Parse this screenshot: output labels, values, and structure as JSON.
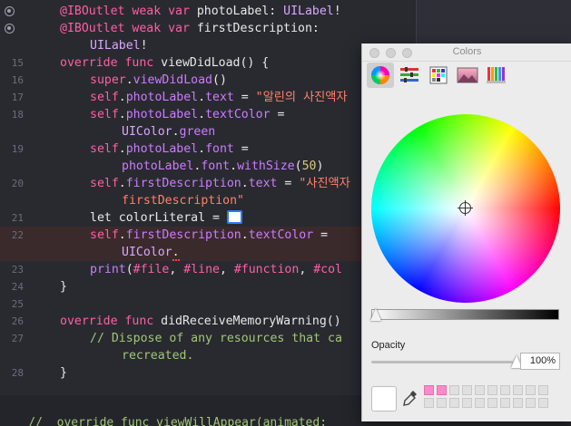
{
  "editor": {
    "lines": [
      {
        "num": "",
        "marker": "outlet",
        "indent": 0,
        "tokens": [
          [
            "kw",
            "@IBOutlet weak var "
          ],
          [
            "pl",
            "photoLabel: "
          ],
          [
            "ty",
            "UILabel"
          ],
          [
            "pl",
            "!"
          ]
        ]
      },
      {
        "num": "",
        "marker": "outlet",
        "indent": 0,
        "tokens": [
          [
            "kw",
            "@IBOutlet weak var "
          ],
          [
            "pl",
            "firstDescription:"
          ]
        ]
      },
      {
        "num": "",
        "marker": "",
        "indent": 1,
        "tokens": [
          [
            "ty",
            "UILabel"
          ],
          [
            "pl",
            "!"
          ]
        ]
      },
      {
        "num": "15",
        "marker": "",
        "indent": 0,
        "tokens": [
          [
            "kw",
            "override func "
          ],
          [
            "pl",
            "viewDidLoad() {"
          ]
        ]
      },
      {
        "num": "16",
        "marker": "",
        "indent": 1,
        "tokens": [
          [
            "kw",
            "super"
          ],
          [
            "pl",
            "."
          ],
          [
            "fn",
            "viewDidLoad"
          ],
          [
            "pl",
            "()"
          ]
        ]
      },
      {
        "num": "17",
        "marker": "",
        "indent": 1,
        "tokens": [
          [
            "kw",
            "self"
          ],
          [
            "pl",
            "."
          ],
          [
            "fn",
            "photoLabel"
          ],
          [
            "pl",
            "."
          ],
          [
            "fn",
            "text"
          ],
          [
            "pl",
            " = "
          ],
          [
            "str",
            "\"알린의 사진액자"
          ]
        ]
      },
      {
        "num": "18",
        "marker": "",
        "indent": 1,
        "tokens": [
          [
            "kw",
            "self"
          ],
          [
            "pl",
            "."
          ],
          [
            "fn",
            "photoLabel"
          ],
          [
            "pl",
            "."
          ],
          [
            "fn",
            "textColor"
          ],
          [
            "pl",
            " ="
          ]
        ]
      },
      {
        "num": "",
        "marker": "",
        "indent": 2,
        "tokens": [
          [
            "ty",
            "UIColor"
          ],
          [
            "pl",
            "."
          ],
          [
            "fn",
            "green"
          ]
        ]
      },
      {
        "num": "19",
        "marker": "",
        "indent": 1,
        "tokens": [
          [
            "kw",
            "self"
          ],
          [
            "pl",
            "."
          ],
          [
            "fn",
            "photoLabel"
          ],
          [
            "pl",
            "."
          ],
          [
            "fn",
            "font"
          ],
          [
            "pl",
            " ="
          ]
        ]
      },
      {
        "num": "",
        "marker": "",
        "indent": 2,
        "tokens": [
          [
            "fn",
            "photoLabel"
          ],
          [
            "pl",
            "."
          ],
          [
            "fn",
            "font"
          ],
          [
            "pl",
            "."
          ],
          [
            "fn",
            "withSize"
          ],
          [
            "pl",
            "("
          ],
          [
            "num",
            "50"
          ],
          [
            "pl",
            ")"
          ]
        ]
      },
      {
        "num": "20",
        "marker": "",
        "indent": 1,
        "tokens": [
          [
            "kw",
            "self"
          ],
          [
            "pl",
            "."
          ],
          [
            "fn",
            "firstDescription"
          ],
          [
            "pl",
            "."
          ],
          [
            "fn",
            "text"
          ],
          [
            "pl",
            " = "
          ],
          [
            "str",
            "\"사진액자"
          ]
        ]
      },
      {
        "num": "",
        "marker": "",
        "indent": 2,
        "tokens": [
          [
            "str",
            "firstDescription\""
          ]
        ]
      },
      {
        "num": "21",
        "marker": "",
        "indent": 1,
        "tokens": [
          [
            "pl",
            "let colorLiteral = "
          ],
          [
            "swatch",
            ""
          ]
        ]
      },
      {
        "num": "22",
        "marker": "",
        "indent": 1,
        "highlight": true,
        "tokens": [
          [
            "kw",
            "self"
          ],
          [
            "pl",
            "."
          ],
          [
            "fn",
            "firstDescription"
          ],
          [
            "pl",
            "."
          ],
          [
            "fn",
            "textColor"
          ],
          [
            "pl",
            " ="
          ]
        ]
      },
      {
        "num": "",
        "marker": "",
        "indent": 2,
        "highlight": true,
        "tokens": [
          [
            "ty",
            "UIColor"
          ],
          [
            "err",
            "."
          ]
        ]
      },
      {
        "num": "23",
        "marker": "",
        "indent": 1,
        "tokens": [
          [
            "fn",
            "print"
          ],
          [
            "pl",
            "("
          ],
          [
            "kw",
            "#file"
          ],
          [
            "pl",
            ", "
          ],
          [
            "kw",
            "#line"
          ],
          [
            "pl",
            ", "
          ],
          [
            "kw",
            "#function"
          ],
          [
            "pl",
            ", "
          ],
          [
            "kw",
            "#col"
          ]
        ]
      },
      {
        "num": "24",
        "marker": "",
        "indent": 0,
        "tokens": [
          [
            "pl",
            "}"
          ]
        ]
      },
      {
        "num": "25",
        "marker": "",
        "indent": 0,
        "tokens": []
      },
      {
        "num": "26",
        "marker": "",
        "indent": 0,
        "tokens": [
          [
            "kw",
            "override func "
          ],
          [
            "pl",
            "didReceiveMemoryWarning()"
          ]
        ]
      },
      {
        "num": "27",
        "marker": "",
        "indent": 1,
        "tokens": [
          [
            "com",
            "// Dispose of any resources that ca"
          ]
        ]
      },
      {
        "num": "",
        "marker": "",
        "indent": 2,
        "tokens": [
          [
            "com",
            "recreated."
          ]
        ]
      },
      {
        "num": "28",
        "marker": "",
        "indent": 0,
        "tokens": [
          [
            "pl",
            "}"
          ]
        ]
      }
    ],
    "bottom_text": "    //  override func viewWillAppear(animated:"
  },
  "colors_panel": {
    "title": "Colors",
    "tabs": [
      "color-wheel",
      "color-sliders",
      "color-palettes",
      "image-palettes",
      "pencils"
    ],
    "selected_tab": "color-wheel",
    "opacity_label": "Opacity",
    "opacity_value": "100%",
    "current_color": "#FFFFFF",
    "swatch_colors": [
      "#FF89C9",
      "#FF89C9"
    ]
  },
  "colors": {
    "editor_bg": "#292A30",
    "keyword": "#FF5FA2",
    "type": "#D8A7FF",
    "string": "#FF8169",
    "comment": "#A2C676",
    "selection": "#2F7CF6"
  }
}
